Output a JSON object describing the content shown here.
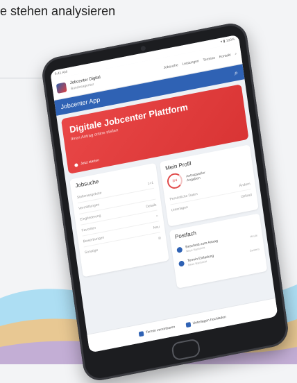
{
  "headline": "e stehen analysieren",
  "app": {
    "status_time": "9:41 AM",
    "status_icons": "▾ ▮ 100%",
    "brand_name": "Jobcenter Digital",
    "brand_sub": "Bundesagentur",
    "menu": [
      "Jobsuche",
      "Leistungen",
      "Termine",
      "Kontakt"
    ],
    "bar_title": "Jobcenter App",
    "hero_title": "Digitale Jobcenter Plattform",
    "hero_sub": "Ihren Antrag online stellen",
    "hero_link": "Jetzt starten",
    "jobsuche": {
      "title": "Jobsuche",
      "rows": [
        {
          "label": "Stellenangebote",
          "value": "1+1"
        },
        {
          "label": "Vermittlungen",
          "value": ""
        },
        {
          "label": "Eingliederung",
          "value": "Details"
        },
        {
          "label": "Favoriten",
          "value": "○"
        },
        {
          "label": "Bewerbungen",
          "value": "Neu"
        },
        {
          "label": "Sonstige",
          "value": "◎"
        }
      ]
    },
    "profil": {
      "title": "Mein Profil",
      "ring_value": "3/4",
      "name": "Antragsteller",
      "name_sub": "Angaben",
      "rows": [
        {
          "label": "Persönliche Daten",
          "value": "Ändern"
        },
        {
          "label": "Unterlagen",
          "value": "Upload"
        }
      ]
    },
    "postfach": {
      "title": "Postfach",
      "items": [
        {
          "title": "Bescheid zum Antrag",
          "sub": "Neue Nachricht",
          "time": "Heute"
        },
        {
          "title": "Termin Einladung",
          "sub": "Neue Nachricht",
          "time": "Gestern"
        }
      ]
    },
    "footer": [
      "Termin vereinbaren",
      "Unterlagen hochladen"
    ]
  },
  "colors": {
    "accent": "#2f62b4",
    "hero": "#e94747"
  }
}
